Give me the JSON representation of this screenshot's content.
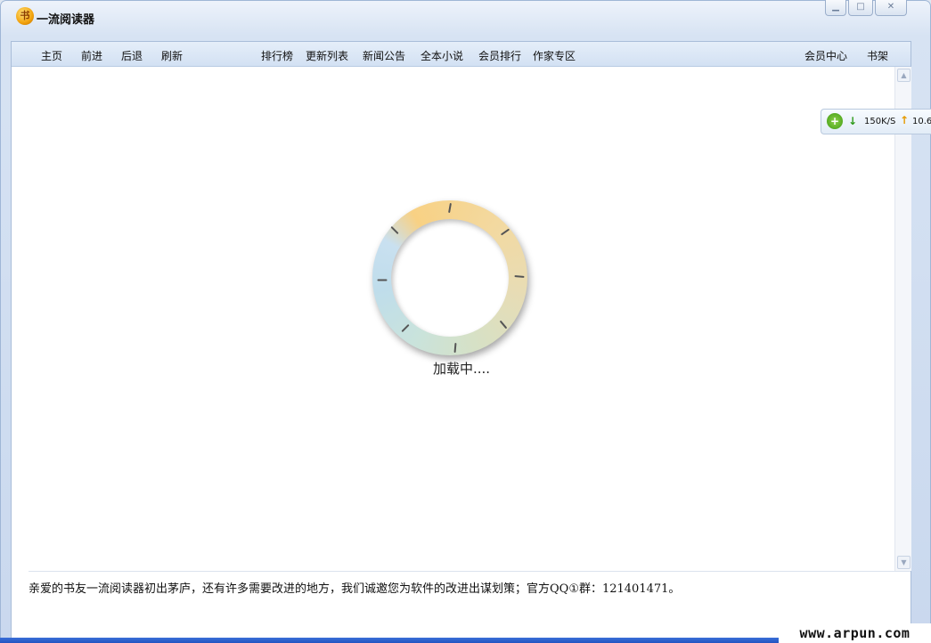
{
  "window": {
    "title": "一流阅读器",
    "logo_glyph": "书",
    "controls": {
      "minimize": "▁",
      "maximize": "□",
      "close": "✕"
    }
  },
  "nav": {
    "left": [
      "主页",
      "前进",
      "后退",
      "刷新"
    ],
    "center": [
      "排行榜",
      "更新列表",
      "新闻公告",
      "全本小说",
      "会员排行",
      "作家专区"
    ],
    "right": [
      "会员中心",
      "书架"
    ]
  },
  "loading": {
    "text": "加载中...."
  },
  "notice": {
    "text": "亲爱的书友一流阅读器初出茅庐，还有许多需要改进的地方，我们诚邀您为软件的改进出谋划策；官方QQ①群：121401471。"
  },
  "speed_widget": {
    "icon": "plus-circle-icon",
    "down_arrow": "↓",
    "down_speed": "150K/S",
    "up_arrow": "↑",
    "up_speed": "10.6"
  },
  "scrollbar": {
    "up": "▲",
    "down": "▼"
  },
  "watermark": "www.arpun.com",
  "colors": {
    "accent": "#d3e1f3",
    "spinner_warm": "#f8d184",
    "spinner_cool": "#bfddeb"
  }
}
